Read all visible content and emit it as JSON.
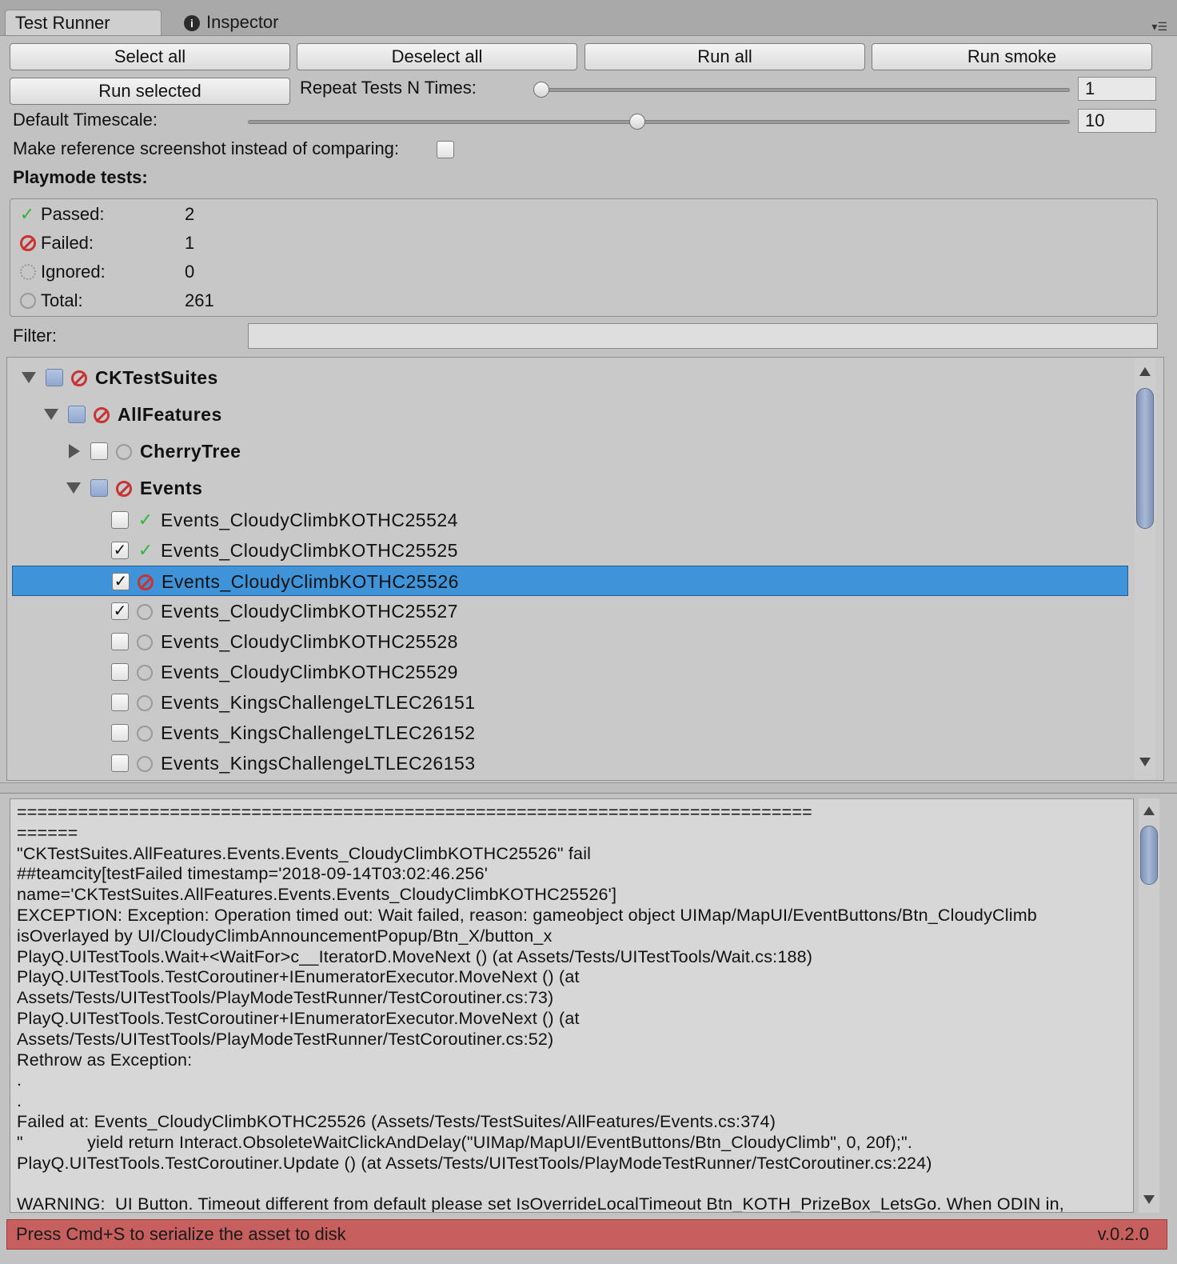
{
  "tabs": [
    {
      "label": "Test Runner",
      "active": true
    },
    {
      "label": "Inspector",
      "active": false,
      "icon": "info-icon"
    }
  ],
  "toolbar": {
    "select_all": "Select all",
    "deselect_all": "Deselect all",
    "run_all": "Run all",
    "run_smoke": "Run smoke",
    "run_selected": "Run selected"
  },
  "settings": {
    "repeat_label": "Repeat Tests N Times:",
    "repeat_value": "1",
    "timescale_label": "Default Timescale:",
    "timescale_value": "10",
    "reference_label": "Make reference screenshot instead of comparing:",
    "reference_checked": false
  },
  "summary": {
    "heading": "Playmode tests:",
    "items": [
      {
        "label": "Passed:",
        "value": "2",
        "icon": "check-icon"
      },
      {
        "label": "Failed:",
        "value": "1",
        "icon": "fail-icon"
      },
      {
        "label": "Ignored:",
        "value": "0",
        "icon": "ignored-icon"
      },
      {
        "label": "Total:",
        "value": "261",
        "icon": "none-icon"
      }
    ]
  },
  "filter": {
    "label": "Filter:",
    "value": ""
  },
  "tree": {
    "rows": [
      {
        "label": "CKTestSuites",
        "expander": "expanded",
        "checkbox": "mixed",
        "status": "fail",
        "bold": true
      },
      {
        "label": "AllFeatures",
        "expander": "expanded",
        "checkbox": "mixed",
        "status": "fail",
        "bold": true
      },
      {
        "label": "CherryTree",
        "expander": "collapsed",
        "checkbox": "unchecked",
        "status": "none",
        "bold": true
      },
      {
        "label": "Events",
        "expander": "expanded",
        "checkbox": "mixed",
        "status": "fail",
        "bold": true
      },
      {
        "label": "Events_CloudyClimbKOTHC25524",
        "checkbox": "unchecked",
        "status": "pass"
      },
      {
        "label": "Events_CloudyClimbKOTHC25525",
        "checkbox": "checked",
        "status": "pass"
      },
      {
        "label": "Events_CloudyClimbKOTHC25526",
        "checkbox": "checked",
        "status": "fail",
        "selected": true
      },
      {
        "label": "Events_CloudyClimbKOTHC25527",
        "checkbox": "checked",
        "status": "none"
      },
      {
        "label": "Events_CloudyClimbKOTHC25528",
        "checkbox": "unchecked",
        "status": "none"
      },
      {
        "label": "Events_CloudyClimbKOTHC25529",
        "checkbox": "unchecked",
        "status": "none"
      },
      {
        "label": "Events_KingsChallengeLTLEC26151",
        "checkbox": "unchecked",
        "status": "none"
      },
      {
        "label": "Events_KingsChallengeLTLEC26152",
        "checkbox": "unchecked",
        "status": "none"
      },
      {
        "label": "Events_KingsChallengeLTLEC26153",
        "checkbox": "unchecked",
        "status": "none"
      }
    ]
  },
  "console": {
    "lines": [
      "==============================================================================",
      "======",
      "\"CKTestSuites.AllFeatures.Events.Events_CloudyClimbKOTHC25526\" fail",
      "##teamcity[testFailed timestamp='2018-09-14T03:02:46.256'",
      "name='CKTestSuites.AllFeatures.Events.Events_CloudyClimbKOTHC25526']",
      "EXCEPTION: Exception: Operation timed out: Wait failed, reason: gameobject object UIMap/MapUI/EventButtons/Btn_CloudyClimb",
      "isOverlayed by UI/CloudyClimbAnnouncementPopup/Btn_X/button_x",
      "PlayQ.UITestTools.Wait+<WaitFor>c__IteratorD.MoveNext () (at Assets/Tests/UITestTools/Wait.cs:188)",
      "PlayQ.UITestTools.TestCoroutiner+IEnumeratorExecutor.MoveNext () (at",
      "Assets/Tests/UITestTools/PlayModeTestRunner/TestCoroutiner.cs:73)",
      "PlayQ.UITestTools.TestCoroutiner+IEnumeratorExecutor.MoveNext () (at",
      "Assets/Tests/UITestTools/PlayModeTestRunner/TestCoroutiner.cs:52)",
      "Rethrow as Exception:",
      ".",
      ".",
      "Failed at: Events_CloudyClimbKOTHC25526 (Assets/Tests/TestSuites/AllFeatures/Events.cs:374)",
      "\"             yield return Interact.ObsoleteWaitClickAndDelay(\"UIMap/MapUI/EventButtons/Btn_CloudyClimb\", 0, 20f);\".",
      "PlayQ.UITestTools.TestCoroutiner.Update () (at Assets/Tests/UITestTools/PlayModeTestRunner/TestCoroutiner.cs:224)",
      "",
      "WARNING:  UI Button. Timeout different from default please set IsOverrideLocalTimeout Btn_KOTH_PrizeBox_LetsGo. When ODIN in,"
    ]
  },
  "statusbar": {
    "message": "Press Cmd+S to serialize the asset to disk",
    "version": "v.0.2.0",
    "color": "#c85f5f"
  },
  "colors": {
    "selection": "#3f93d8",
    "pass": "#34b33c",
    "fail": "#c83434"
  }
}
